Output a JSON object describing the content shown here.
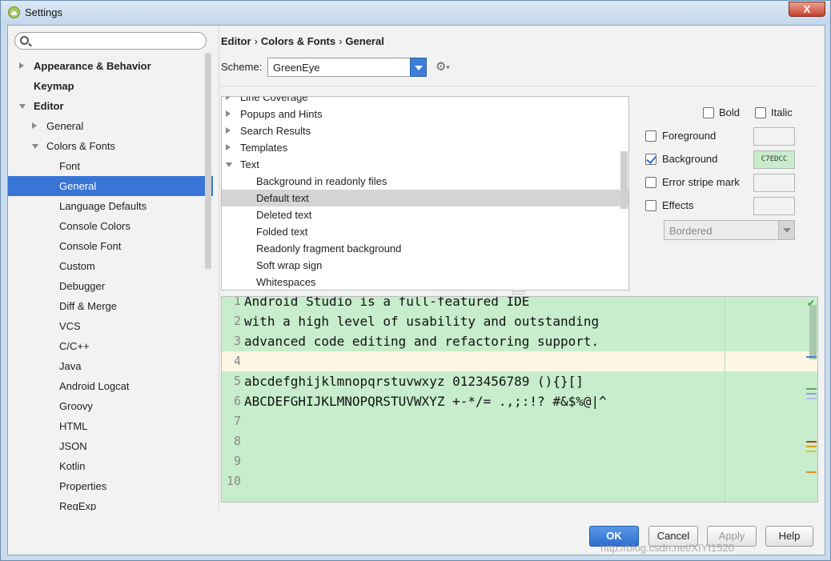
{
  "window": {
    "title": "Settings",
    "close_label": "X"
  },
  "search": {
    "placeholder": "",
    "value": ""
  },
  "nav": [
    {
      "label": "Appearance & Behavior",
      "level": 0,
      "bold": true,
      "arrow": "right"
    },
    {
      "label": "Keymap",
      "level": 0,
      "bold": true,
      "arrow": "none"
    },
    {
      "label": "Editor",
      "level": 0,
      "bold": true,
      "arrow": "down"
    },
    {
      "label": "General",
      "level": 1,
      "bold": false,
      "arrow": "right"
    },
    {
      "label": "Colors & Fonts",
      "level": 1,
      "bold": false,
      "arrow": "down"
    },
    {
      "label": "Font",
      "level": 2,
      "bold": false,
      "arrow": "none"
    },
    {
      "label": "General",
      "level": 2,
      "bold": false,
      "arrow": "none",
      "selected": true
    },
    {
      "label": "Language Defaults",
      "level": 2,
      "bold": false,
      "arrow": "none"
    },
    {
      "label": "Console Colors",
      "level": 2,
      "bold": false,
      "arrow": "none"
    },
    {
      "label": "Console Font",
      "level": 2,
      "bold": false,
      "arrow": "none"
    },
    {
      "label": "Custom",
      "level": 2,
      "bold": false,
      "arrow": "none"
    },
    {
      "label": "Debugger",
      "level": 2,
      "bold": false,
      "arrow": "none"
    },
    {
      "label": "Diff & Merge",
      "level": 2,
      "bold": false,
      "arrow": "none"
    },
    {
      "label": "VCS",
      "level": 2,
      "bold": false,
      "arrow": "none"
    },
    {
      "label": "C/C++",
      "level": 2,
      "bold": false,
      "arrow": "none"
    },
    {
      "label": "Java",
      "level": 2,
      "bold": false,
      "arrow": "none"
    },
    {
      "label": "Android Logcat",
      "level": 2,
      "bold": false,
      "arrow": "none"
    },
    {
      "label": "Groovy",
      "level": 2,
      "bold": false,
      "arrow": "none"
    },
    {
      "label": "HTML",
      "level": 2,
      "bold": false,
      "arrow": "none"
    },
    {
      "label": "JSON",
      "level": 2,
      "bold": false,
      "arrow": "none"
    },
    {
      "label": "Kotlin",
      "level": 2,
      "bold": false,
      "arrow": "none"
    },
    {
      "label": "Properties",
      "level": 2,
      "bold": false,
      "arrow": "none"
    },
    {
      "label": "RegExp",
      "level": 2,
      "bold": false,
      "arrow": "none"
    }
  ],
  "breadcrumb": {
    "part1": "Editor",
    "part2": "Colors & Fonts",
    "part3": "General",
    "separator": "›"
  },
  "scheme": {
    "label": "Scheme:",
    "value": "GreenEye",
    "gear": "gear-icon"
  },
  "tree": [
    {
      "label": "Line Coverage",
      "level": 0,
      "arrow": "right"
    },
    {
      "label": "Popups and Hints",
      "level": 0,
      "arrow": "right"
    },
    {
      "label": "Search Results",
      "level": 0,
      "arrow": "right"
    },
    {
      "label": "Templates",
      "level": 0,
      "arrow": "right"
    },
    {
      "label": "Text",
      "level": 0,
      "arrow": "down"
    },
    {
      "label": "Background in readonly files",
      "level": 1,
      "arrow": "none"
    },
    {
      "label": "Default text",
      "level": 1,
      "arrow": "none",
      "selected": true
    },
    {
      "label": "Deleted text",
      "level": 1,
      "arrow": "none"
    },
    {
      "label": "Folded text",
      "level": 1,
      "arrow": "none"
    },
    {
      "label": "Readonly fragment background",
      "level": 1,
      "arrow": "none"
    },
    {
      "label": "Soft wrap sign",
      "level": 1,
      "arrow": "none"
    },
    {
      "label": "Whitespaces",
      "level": 1,
      "arrow": "none"
    }
  ],
  "options": {
    "bold": {
      "label": "Bold",
      "checked": false
    },
    "italic": {
      "label": "Italic",
      "checked": false
    },
    "foreground": {
      "label": "Foreground",
      "checked": false,
      "value": ""
    },
    "background": {
      "label": "Background",
      "checked": true,
      "value": "C7EDCC"
    },
    "error_stripe": {
      "label": "Error stripe mark",
      "checked": false,
      "value": ""
    },
    "effects": {
      "label": "Effects",
      "checked": false,
      "value": ""
    },
    "effects_type": "Bordered"
  },
  "editor": {
    "lines": [
      {
        "num": "1",
        "text": "Android Studio is a full-featured IDE"
      },
      {
        "num": "2",
        "text": "with a high level of usability and outstanding"
      },
      {
        "num": "3",
        "text": "advanced code editing and refactoring support."
      },
      {
        "num": "4",
        "text": "",
        "caret": true
      },
      {
        "num": "5",
        "text": "abcdefghijklmnopqrstuvwxyz 0123456789 (){}[]"
      },
      {
        "num": "6",
        "text": "ABCDEFGHIJKLMNOPQRSTUVWXYZ +-*/= .,;:!? #&$%@|^"
      },
      {
        "num": "7",
        "text": ""
      },
      {
        "num": "8",
        "text": ""
      },
      {
        "num": "9",
        "text": ""
      },
      {
        "num": "10",
        "text": ""
      }
    ],
    "background_color": "#C7EDCC",
    "caret_row_color": "#FCF6E2"
  },
  "buttons": {
    "ok": "OK",
    "cancel": "Cancel",
    "apply": "Apply",
    "help": "Help"
  },
  "watermark": "http://blog.csdn.net/XIYI1520"
}
